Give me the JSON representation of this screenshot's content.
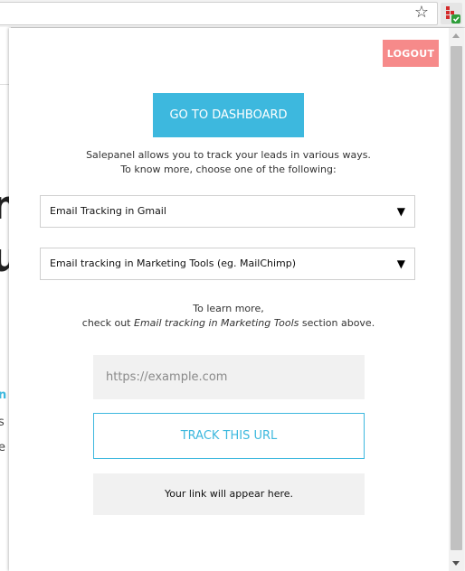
{
  "browser": {
    "star_icon": "☆",
    "extension_icon": "salepanel-extension-icon"
  },
  "background_page": {
    "fragments": [
      "n",
      "u",
      "n",
      "s",
      "e"
    ]
  },
  "popup": {
    "logout_label": "LOGOUT",
    "dashboard_label": "GO TO DASHBOARD",
    "intro_line1": "Salepanel allows you to track your leads in various ways.",
    "intro_line2": "To know more, choose one of the following:",
    "select1": {
      "selected": "Email Tracking in Gmail",
      "arrow": "▼"
    },
    "select2": {
      "selected": "Email tracking in Marketing Tools (eg. MailChimp)",
      "arrow": "▼"
    },
    "learn_line1": "To learn more,",
    "learn_prefix": "check out ",
    "learn_emphasis": "Email tracking in Marketing Tools",
    "learn_suffix": " section above.",
    "url_input": {
      "value": "",
      "placeholder": "https://example.com"
    },
    "track_label": "TRACK THIS URL",
    "result_text": "Your link will appear here."
  },
  "colors": {
    "accent": "#3db8de",
    "logout": "#f68a8a",
    "field_bg": "#f1f1f1"
  }
}
